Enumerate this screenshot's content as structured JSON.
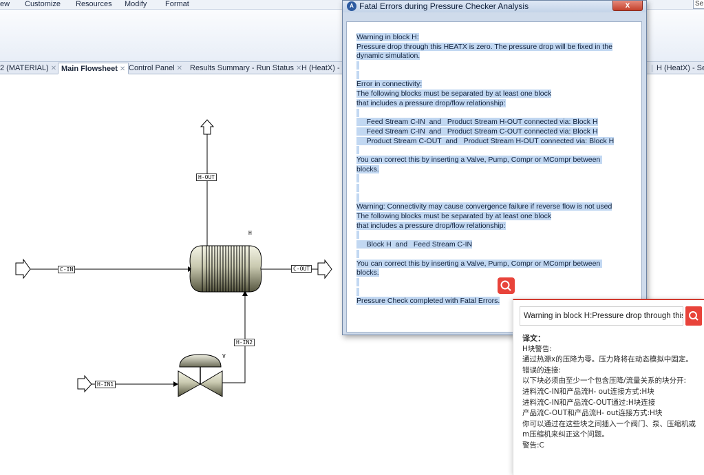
{
  "menu": {
    "items": [
      "ew",
      "Customize",
      "Resources",
      "Modify",
      "Format"
    ],
    "search_text": "Se"
  },
  "tabs": [
    {
      "label": "2 (MATERIAL)",
      "closable": true
    },
    {
      "label": "Main Flowsheet",
      "closable": true,
      "active": true
    },
    {
      "label": "Control Panel",
      "closable": true
    },
    {
      "label": "Results Summary - Run Status",
      "closable": true
    },
    {
      "label": "H (HeatX) - I",
      "closable": false
    },
    {
      "label": "H (HeatX) - Set",
      "closable": false
    }
  ],
  "flowsheet": {
    "streams": {
      "h_out": "H-OUT",
      "c_in": "C-IN",
      "c_out": "C-OUT",
      "h_in2": "H-IN2",
      "h_in1": "H-IN1"
    },
    "blocks": {
      "heatx": "H",
      "valve": "V"
    }
  },
  "dialog": {
    "title": "Fatal Errors during Pressure Checker Analysis",
    "close_glyph": "x",
    "lines": [
      "Warning in block H:",
      "Pressure drop through this HEATX is zero. The pressure drop will be fixed in the",
      "dynamic simulation.",
      "",
      "",
      "Error in connectivity:",
      "The following blocks must be separated by at least one block",
      "that includes a pressure drop/flow relationship:",
      "",
      "     Feed Stream C-IN  and   Product Stream H-OUT connected via: Block H",
      "     Feed Stream C-IN  and   Product Stream C-OUT connected via: Block H",
      "     Product Stream C-OUT  and   Product Stream H-OUT connected via: Block H",
      "",
      "You can correct this by inserting a Valve, Pump, Compr or MCompr between these",
      "blocks.",
      "",
      "",
      "",
      "Warning: Connectivity may cause convergence failure if reverse flow is not used",
      "The following blocks must be separated by at least one block",
      "that includes a pressure drop/flow relationship:",
      "",
      "     Block H  and   Feed Stream C-IN",
      "",
      "You can correct this by inserting a Valve, Pump, Compr or MCompr between these",
      "blocks.",
      "",
      "",
      "Pressure Check completed with Fatal Errors."
    ]
  },
  "translation": {
    "input": "Warning in block H:Pressure drop through this HEATX is zero.",
    "heading": "译文：",
    "lines": [
      "H块警告:",
      "通过热源x的压降为零。压力降将在动态模拟中固定。",
      "错误的连接:",
      "以下块必须由至少一个包含压降/流量关系的块分开:",
      "进料流C-IN和产品流H- out连接方式:H块",
      "进料流C-IN和产品流C-OUT通过:H块连接",
      "产品流C-OUT和产品流H- out连接方式:H块",
      "你可以通过在这些块之间插入一个阀门、泵、压缩机或m压缩机来纠正这个问题。",
      "警告:C"
    ]
  }
}
